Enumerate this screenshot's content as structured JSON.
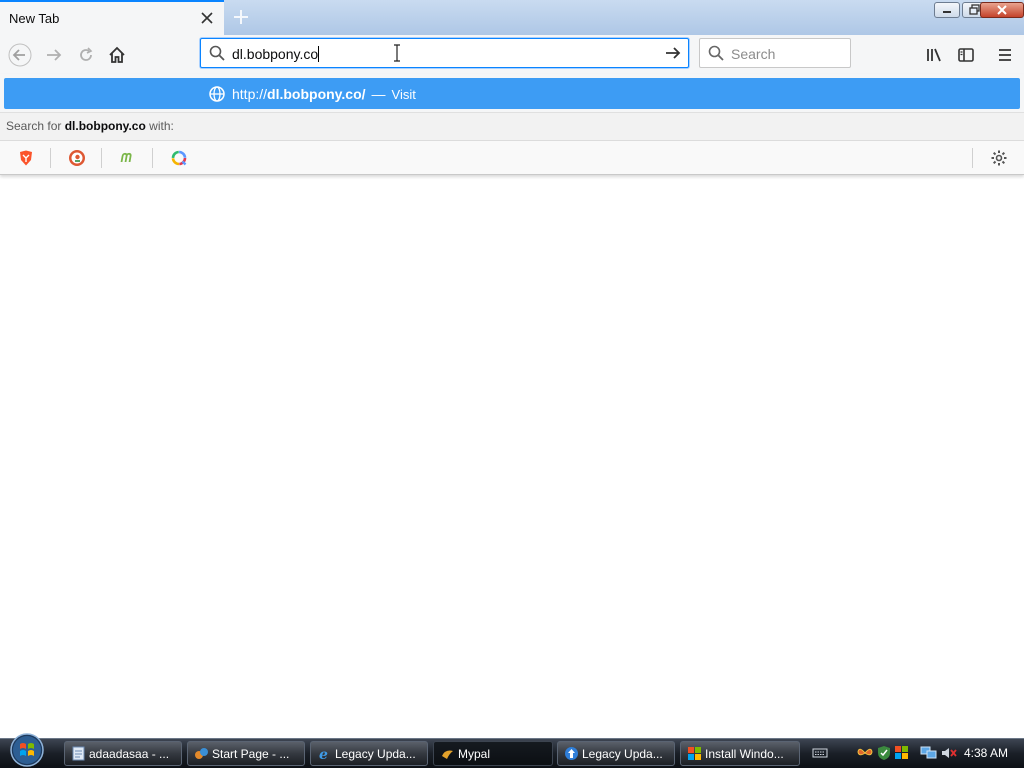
{
  "window": {
    "tab_title": "New Tab",
    "colors": {
      "accent": "#0a84ff",
      "highlight": "#3d9cf4",
      "toolbar": "#f5f6f7"
    }
  },
  "navbar": {
    "url_value": "dl.bobpony.co",
    "search_placeholder": "Search"
  },
  "popup": {
    "suggestion": {
      "prefix": "http://",
      "host": "dl.bobpony.co/",
      "separator": "—",
      "action": "Visit"
    },
    "search_for": {
      "before": "Search for",
      "term": "dl.bobpony.co",
      "after": "with:"
    },
    "engines": [
      {
        "icon": "brave-icon",
        "color": "#fb542b"
      },
      {
        "icon": "duckduckgo-icon",
        "color": "#de5833"
      },
      {
        "icon": "mojeek-icon",
        "color": "#7ab648"
      },
      {
        "icon": "qwant-icon",
        "color": "#5c97ff"
      }
    ]
  },
  "taskbar": {
    "items": [
      {
        "label": "adaadasaa - ...",
        "icon": "notepad-icon"
      },
      {
        "label": "Start Page - ...",
        "icon": "mypal-icon"
      },
      {
        "label": "Legacy Upda...",
        "icon": "ie-icon"
      },
      {
        "label": "Mypal",
        "icon": "mypal-icon"
      },
      {
        "label": "Legacy Upda...",
        "icon": "update-icon"
      },
      {
        "label": "Install Windo...",
        "icon": "windows-icon"
      }
    ],
    "clock": "4:38 AM"
  }
}
